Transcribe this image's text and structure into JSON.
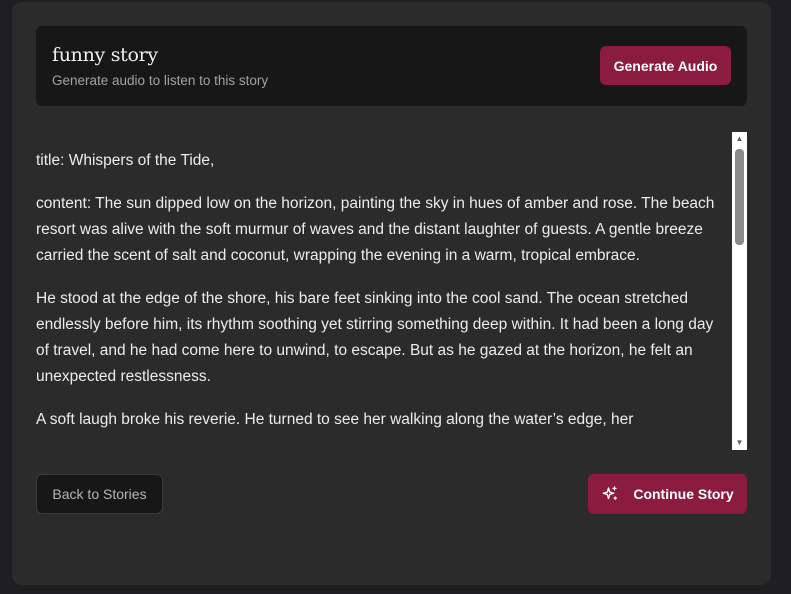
{
  "header": {
    "title": "funny story",
    "subtitle": "Generate audio to listen to this story",
    "generate_label": "Generate Audio"
  },
  "story": {
    "paragraphs": [
      "title: Whispers of the Tide,",
      "content: The sun dipped low on the horizon, painting the sky in hues of amber and rose. The beach resort was alive with the soft murmur of waves and the distant laughter of guests. A gentle breeze carried the scent of salt and coconut, wrapping the evening in a warm, tropical embrace.",
      "He stood at the edge of the shore, his bare feet sinking into the cool sand. The ocean stretched endlessly before him, its rhythm soothing yet stirring something deep within. It had been a long day of travel, and he had come here to unwind, to escape. But as he gazed at the horizon, he felt an unexpected restlessness.",
      "A soft laugh broke his reverie. He turned to see her walking along the water’s edge, her"
    ]
  },
  "footer": {
    "back_label": "Back to Stories",
    "continue_label": "Continue Story",
    "continue_icon": "sparkles-icon"
  },
  "colors": {
    "accent": "#8c1c3f",
    "card": "#2b2b2c",
    "header": "#171718"
  }
}
